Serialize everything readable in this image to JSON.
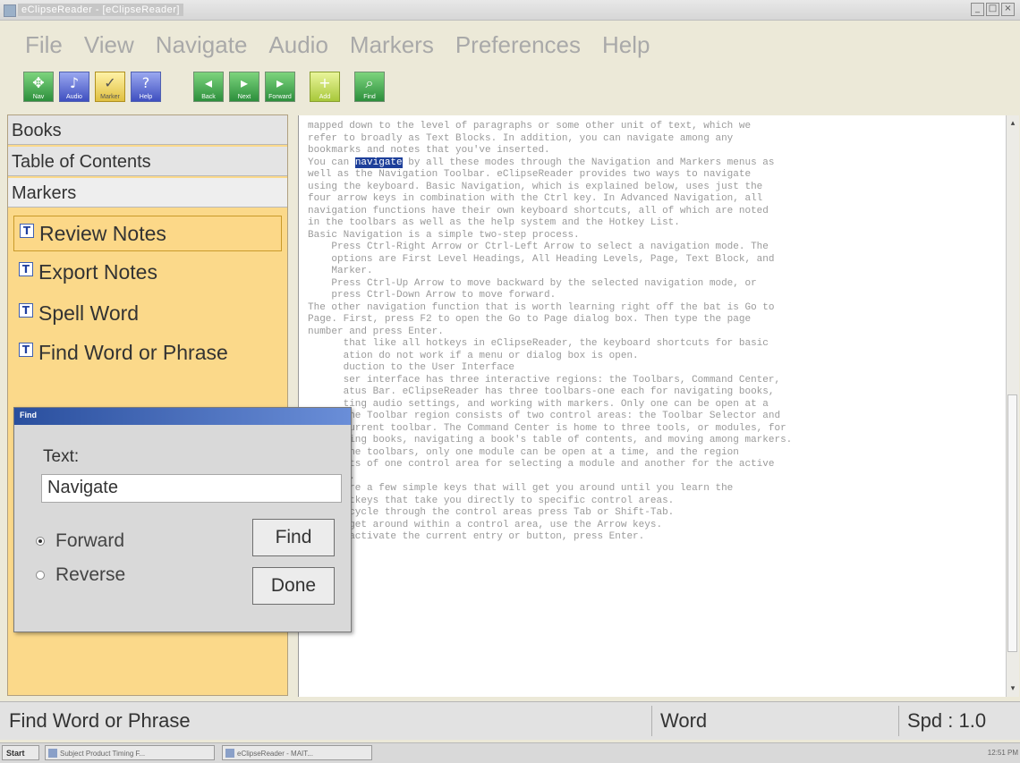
{
  "window": {
    "title": "eClipseReader - [eClipseReader]"
  },
  "menu": [
    "File",
    "View",
    "Navigate",
    "Audio",
    "Markers",
    "Preferences",
    "Help"
  ],
  "toolbar": [
    {
      "icon": "navigate-icon",
      "caption": "Nav"
    },
    {
      "icon": "audio-icon",
      "caption": "Audio"
    },
    {
      "icon": "marker-icon",
      "caption": "Marker"
    },
    {
      "icon": "help-icon",
      "caption": "Help"
    },
    {
      "icon": "back-icon",
      "caption": "Back"
    },
    {
      "icon": "next-icon",
      "caption": "Next"
    },
    {
      "icon": "forward-icon",
      "caption": "Forward"
    },
    {
      "icon": "add-icon",
      "caption": "Add"
    },
    {
      "icon": "find-icon",
      "caption": "Find"
    }
  ],
  "sidebar": {
    "tabs": [
      "Books",
      "Table of Contents",
      "Markers"
    ],
    "items": [
      "Review Notes",
      "Export Notes",
      "Spell Word",
      "Find Word or Phrase"
    ]
  },
  "content": {
    "before_highlight": "mapped down to the level of paragraphs or some other unit of text, which we\nrefer to broadly as Text Blocks. In addition, you can navigate among any\nbookmarks and notes that you've inserted.\nYou can ",
    "highlight": "navigate",
    "after_highlight": " by all these modes through the Navigation and Markers menus as\nwell as the Navigation Toolbar. eClipseReader provides two ways to navigate\nusing the keyboard. Basic Navigation, which is explained below, uses just the\nfour arrow keys in combination with the Ctrl key. In Advanced Navigation, all\nnavigation functions have their own keyboard shortcuts, all of which are noted\nin the toolbars as well as the help system and the Hotkey List.\nBasic Navigation is a simple two-step process.\n    Press Ctrl-Right Arrow or Ctrl-Left Arrow to select a navigation mode. The\n    options are First Level Headings, All Heading Levels, Page, Text Block, and\n    Marker.\n    Press Ctrl-Up Arrow to move backward by the selected navigation mode, or\n    press Ctrl-Down Arrow to move forward.\nThe other navigation function that is worth learning right off the bat is Go to\nPage. First, press F2 to open the Go to Page dialog box. Then type the page\nnumber and press Enter.\n      that like all hotkeys in eClipseReader, the keyboard shortcuts for basic\n      ation do not work if a menu or dialog box is open.\n      duction to the User Interface\n      ser interface has three interactive regions: the Toolbars, Command Center,\n      atus Bar. eClipseReader has three toolbars-one each for navigating books,\n      ting audio settings, and working with markers. Only one can be open at a\n      The Toolbar region consists of two control areas: the Toolbar Selector and\n      current toolbar. The Command Center is home to three tools, or modules, for\n      ting books, navigating a book's table of contents, and moving among markers.\n      the toolbars, only one module can be open at a time, and the region\n      sts of one control area for selecting a module and another for the active\n      e.\n      are a few simple keys that will get you around until you learn the\n      otkeys that take you directly to specific control areas.\n    To cycle through the control areas press Tab or Shift-Tab.\n    To get around within a control area, use the Arrow keys.\n    To activate the current entry or button, press Enter."
  },
  "dialog": {
    "title": "Find",
    "label": "Text:",
    "input_value": "Navigate",
    "radio_forward": "Forward",
    "radio_reverse": "Reverse",
    "find_button": "Find",
    "done_button": "Done"
  },
  "status": {
    "left": "Find Word or Phrase",
    "mid": "Word",
    "right": "Spd : 1.0"
  },
  "taskbar": {
    "start": "Start",
    "task1": "Subject Product Timing F...",
    "task2": "eClipseReader - MAIT...",
    "clock": "12:51 PM"
  }
}
